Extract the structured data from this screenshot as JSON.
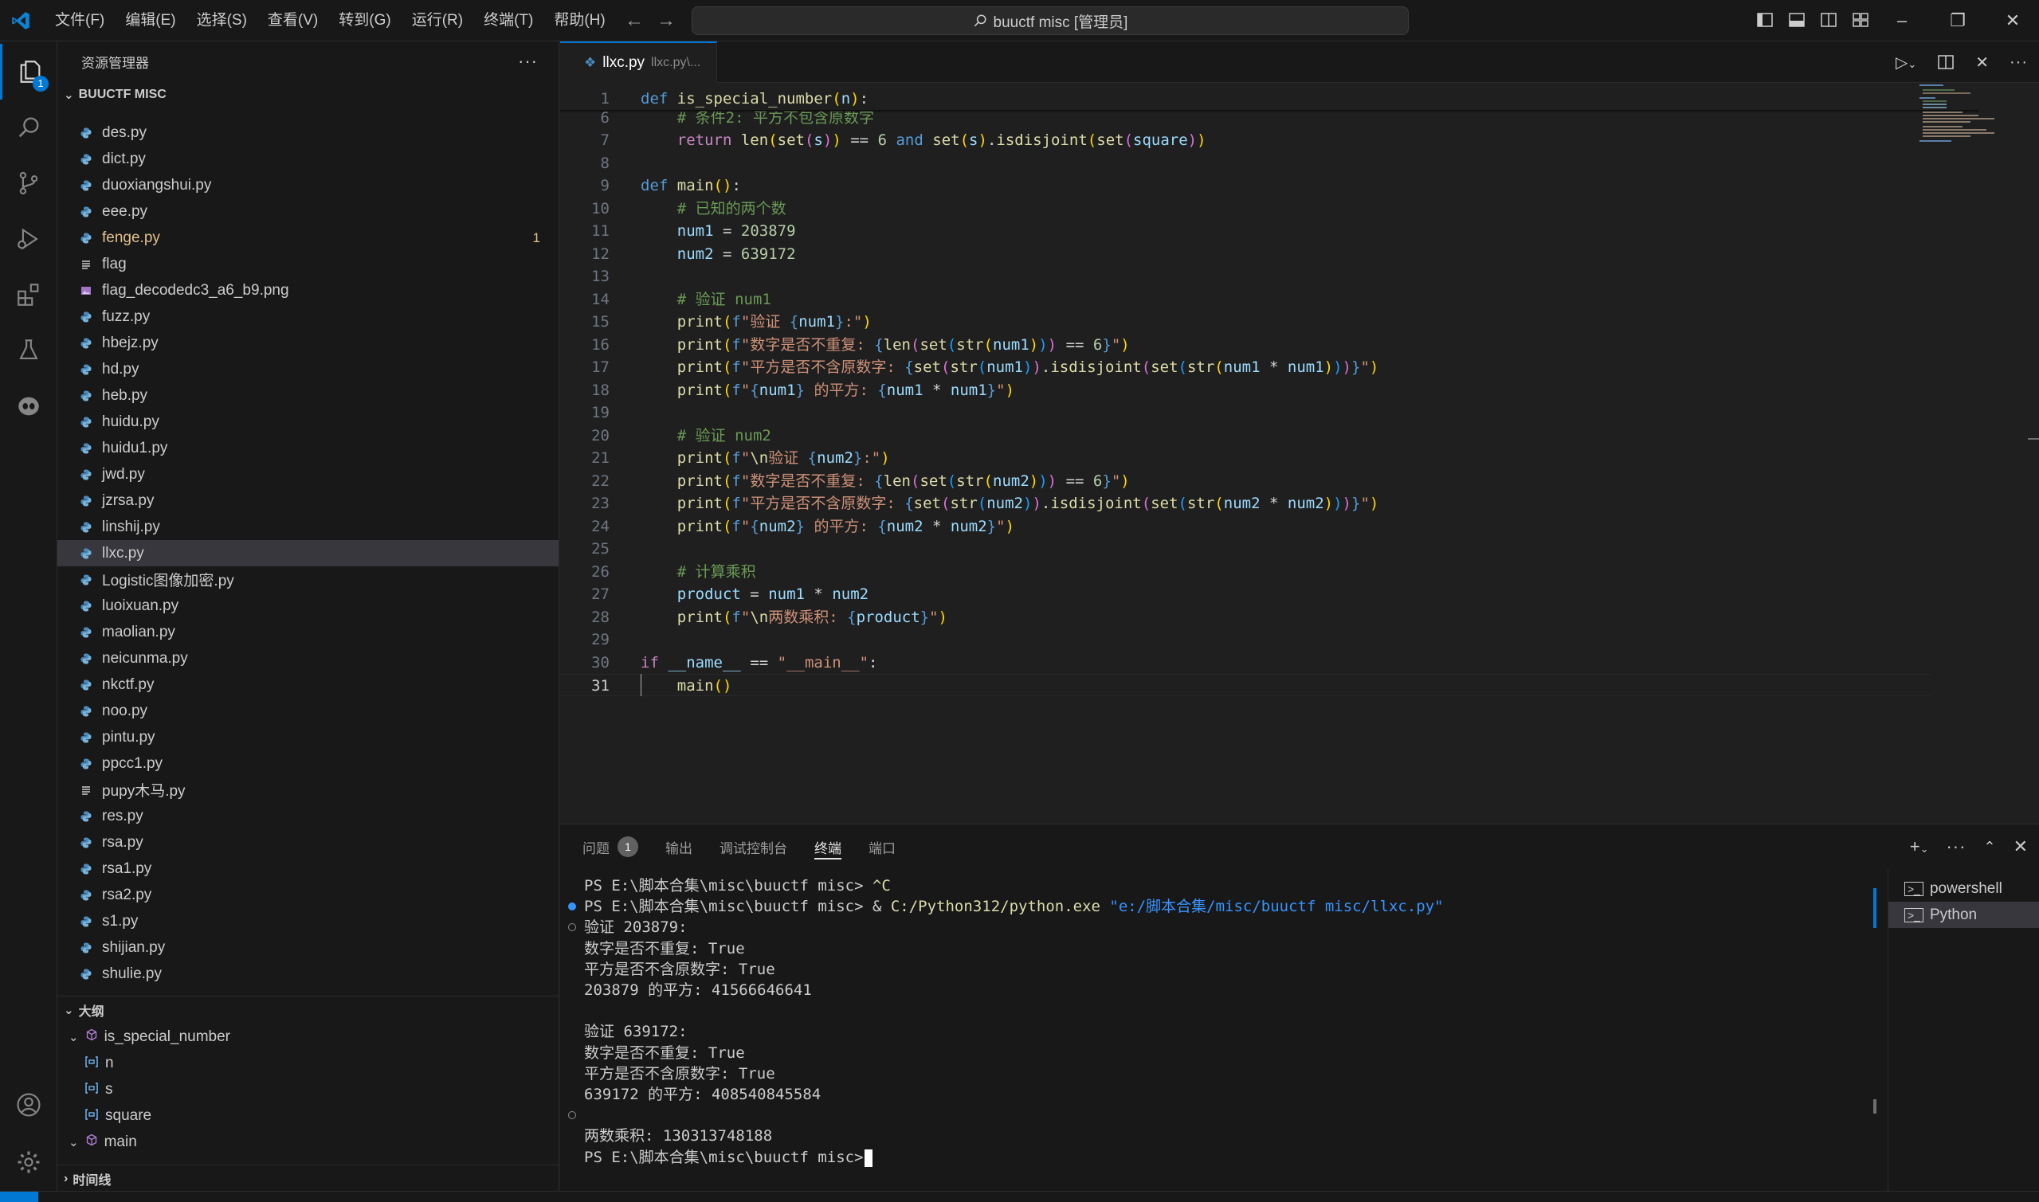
{
  "titlebar": {
    "menus": [
      "文件(F)",
      "编辑(E)",
      "选择(S)",
      "查看(V)",
      "转到(G)",
      "运行(R)",
      "终端(T)",
      "帮助(H)"
    ],
    "search_text": "buuctf misc [管理员]"
  },
  "activitybar": {
    "explorer_badge": "1"
  },
  "sidebar": {
    "header": "资源管理器",
    "folder": "BUUCTF MISC",
    "files": [
      {
        "name": "des.py",
        "icon": "python"
      },
      {
        "name": "dict.py",
        "icon": "python"
      },
      {
        "name": "duoxiangshui.py",
        "icon": "python"
      },
      {
        "name": "eee.py",
        "icon": "python"
      },
      {
        "name": "fenge.py",
        "icon": "python",
        "modified": true,
        "count": "1"
      },
      {
        "name": "flag",
        "icon": "text"
      },
      {
        "name": "flag_decodedc3_a6_b9.png",
        "icon": "image"
      },
      {
        "name": "fuzz.py",
        "icon": "python"
      },
      {
        "name": "hbejz.py",
        "icon": "python"
      },
      {
        "name": "hd.py",
        "icon": "python"
      },
      {
        "name": "heb.py",
        "icon": "python"
      },
      {
        "name": "huidu.py",
        "icon": "python"
      },
      {
        "name": "huidu1.py",
        "icon": "python"
      },
      {
        "name": "jwd.py",
        "icon": "python"
      },
      {
        "name": "jzrsa.py",
        "icon": "python"
      },
      {
        "name": "linshij.py",
        "icon": "python"
      },
      {
        "name": "llxc.py",
        "icon": "python",
        "selected": true
      },
      {
        "name": "Logistic图像加密.py",
        "icon": "python"
      },
      {
        "name": "luoixuan.py",
        "icon": "python"
      },
      {
        "name": "maolian.py",
        "icon": "python"
      },
      {
        "name": "neicunma.py",
        "icon": "python"
      },
      {
        "name": "nkctf.py",
        "icon": "python"
      },
      {
        "name": "noo.py",
        "icon": "python"
      },
      {
        "name": "pintu.py",
        "icon": "python"
      },
      {
        "name": "ppcc1.py",
        "icon": "python"
      },
      {
        "name": "pupy木马.py",
        "icon": "text"
      },
      {
        "name": "res.py",
        "icon": "python"
      },
      {
        "name": "rsa.py",
        "icon": "python"
      },
      {
        "name": "rsa1.py",
        "icon": "python"
      },
      {
        "name": "rsa2.py",
        "icon": "python"
      },
      {
        "name": "s1.py",
        "icon": "python"
      },
      {
        "name": "shijian.py",
        "icon": "python"
      },
      {
        "name": "shulie.py",
        "icon": "python"
      }
    ],
    "outline_title": "大纲",
    "outline": [
      {
        "name": "is_special_number",
        "kind": "function",
        "level": 0
      },
      {
        "name": "n",
        "kind": "variable",
        "level": 1
      },
      {
        "name": "s",
        "kind": "variable",
        "level": 1
      },
      {
        "name": "square",
        "kind": "variable",
        "level": 1
      },
      {
        "name": "main",
        "kind": "function",
        "level": 0
      }
    ],
    "timeline_title": "时间线"
  },
  "editor": {
    "tab_name": "llxc.py",
    "tab_path": "llxc.py\\...",
    "current_line": "31"
  },
  "panel": {
    "tabs": [
      {
        "label": "问题",
        "count": "1"
      },
      {
        "label": "输出"
      },
      {
        "label": "调试控制台"
      },
      {
        "label": "终端",
        "active": true
      },
      {
        "label": "端口"
      }
    ],
    "terminal_lines": [
      "PS E:\\脚本合集\\misc\\buuctf misc> ^C",
      "PS E:\\脚本合集\\misc\\buuctf misc> & C:/Python312/python.exe \"e:/脚本合集/misc/buuctf misc/llxc.py\"",
      "验证 203879:",
      "数字是否不重复: True",
      "平方是否不含原数字: True",
      "203879 的平方: 41566646641",
      "",
      "验证 639172:",
      "数字是否不重复: True",
      "平方是否不含原数字: True",
      "639172 的平方: 408540845584",
      "",
      "两数乘积: 130313748188",
      "PS E:\\脚本合集\\misc\\buuctf misc> "
    ],
    "terminals": [
      "powershell",
      "Python"
    ]
  }
}
